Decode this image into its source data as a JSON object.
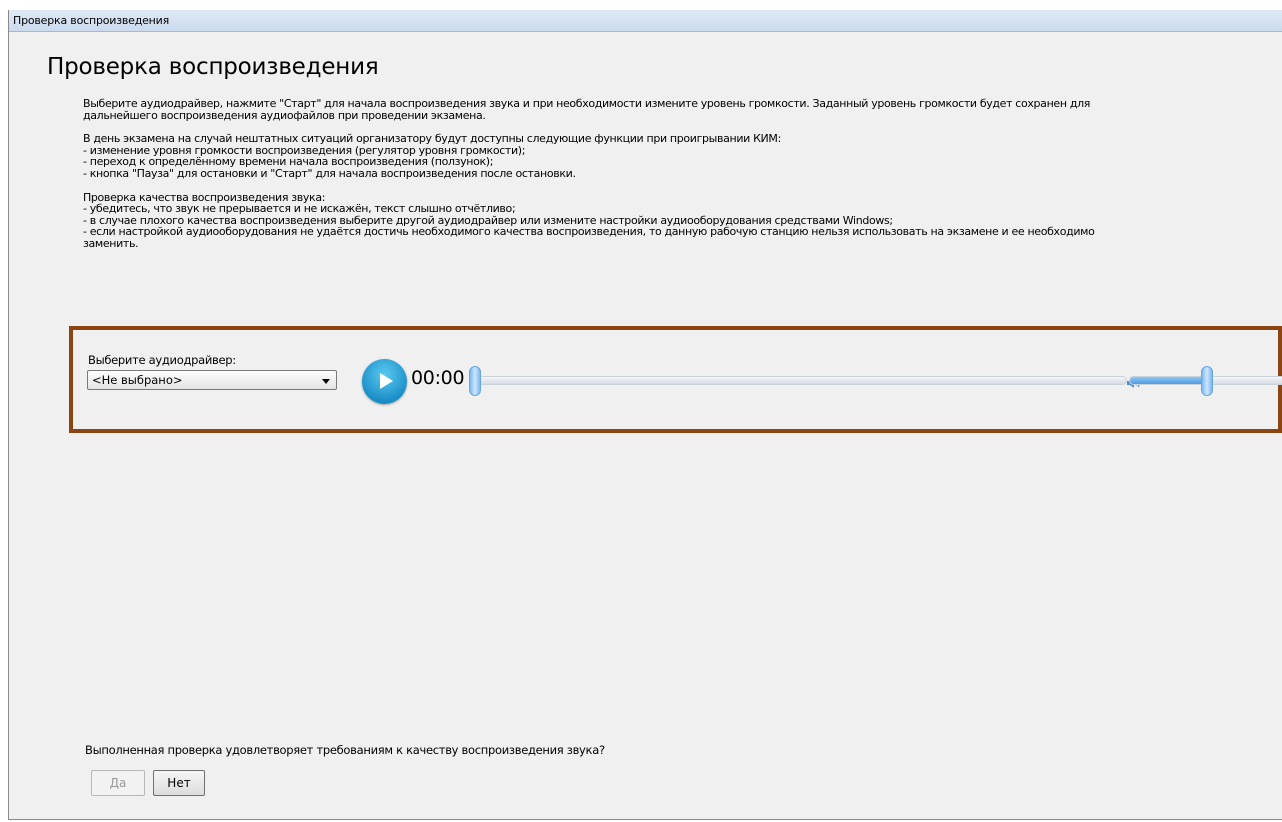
{
  "window": {
    "title": "Проверка воспроизведения"
  },
  "page": {
    "heading": "Проверка воспроизведения"
  },
  "instructions": {
    "paragraph1": "Выберите аудиодрайвер, нажмите \"Старт\" для начала воспроизведения звука и при необходимости измените уровень громкости. Заданный уровень громкости будет сохранен для\nдальнейшего воспроизведения аудиофайлов при проведении экзамена.",
    "paragraph2": "В день экзамена на случай нештатных ситуаций организатору будут доступны следующие функции при проигрывании КИМ:\n - изменение уровня громкости воспроизведения (регулятор уровня громкости);\n - переход к определённому времени начала воспроизведения (ползунок);\n - кнопка \"Пауза\" для остановки и \"Старт\" для начала воспроизведения после остановки.",
    "paragraph3": "Проверка качества воспроизведения звука:\n - убедитесь, что звук не прерывается и не искажён, текст слышно отчётливо;\n - в случае плохого качества воспроизведения выберите другой аудиодрайвер или измените настройки аудиооборудования средствами Windows;\n - если настройкой аудиооборудования не удаётся достичь необходимого качества воспроизведения, то данную рабочую станцию нельзя использовать на экзамене и ее необходимо\nзаменить."
  },
  "player": {
    "driver_label": "Выберите аудиодрайвер:",
    "driver_selected": "<Не выбрано>",
    "time": "00:00",
    "icons": {
      "play": "play-icon",
      "speaker": "speaker-icon",
      "dropdown": "chevron-down-icon"
    },
    "progress_fraction": 0,
    "volume_fraction": 0.5
  },
  "confirmation": {
    "question": "Выполненная проверка удовлетворяет требованиям к качеству воспроизведения звука?",
    "yes_label": "Да",
    "no_label": "Нет"
  },
  "colors": {
    "panel_border": "#8b4513",
    "play_button": "#1a8fc8"
  }
}
